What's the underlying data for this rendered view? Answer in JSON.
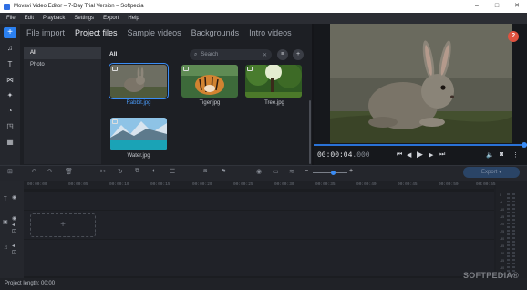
{
  "window": {
    "title": "Movavi Video Editor – 7-Day Trial Version – Softpedia",
    "controls": [
      "–",
      "□",
      "✕"
    ]
  },
  "menu": [
    "File",
    "Edit",
    "Playback",
    "Settings",
    "Export",
    "Help"
  ],
  "tabs": [
    {
      "label": "File import",
      "active": false
    },
    {
      "label": "Project files",
      "active": true
    },
    {
      "label": "Sample videos",
      "active": false
    },
    {
      "label": "Backgrounds",
      "active": false
    },
    {
      "label": "Intro videos",
      "active": false
    }
  ],
  "categories": [
    {
      "label": "All",
      "selected": true
    },
    {
      "label": "Photo",
      "selected": false
    }
  ],
  "content": {
    "heading": "All",
    "search_placeholder": "Search",
    "files": [
      {
        "name": "Rabbit.jpg",
        "selected": true
      },
      {
        "name": "Tiger.jpg",
        "selected": false
      },
      {
        "name": "Tree.jpg",
        "selected": false
      },
      {
        "name": "Water.jpg",
        "selected": false
      }
    ]
  },
  "player": {
    "timecode_main": "00:00:04",
    "timecode_ms": ".000",
    "help_label": "?"
  },
  "timeline": {
    "export_label": "Export",
    "ruler_ticks": [
      "00:00:00",
      "00:00:05",
      "00:00:10",
      "00:00:15",
      "00:00:20",
      "00:00:25",
      "00:00:30",
      "00:00:35",
      "00:00:40",
      "00:00:45",
      "00:00:50",
      "00:00:55"
    ],
    "drop_zone_label": "+",
    "meter_levels": [
      "0",
      "-5",
      "-10",
      "-15",
      "-20",
      "-25",
      "-30",
      "-35",
      "-40",
      "-45",
      "-50",
      "-55"
    ]
  },
  "status": {
    "project_length": "Project length: 00:00"
  },
  "watermark": "SOFTPEDIA®",
  "colors": {
    "accent": "#3a8cf4",
    "help": "#e0523f",
    "background": "#1d1f24"
  }
}
